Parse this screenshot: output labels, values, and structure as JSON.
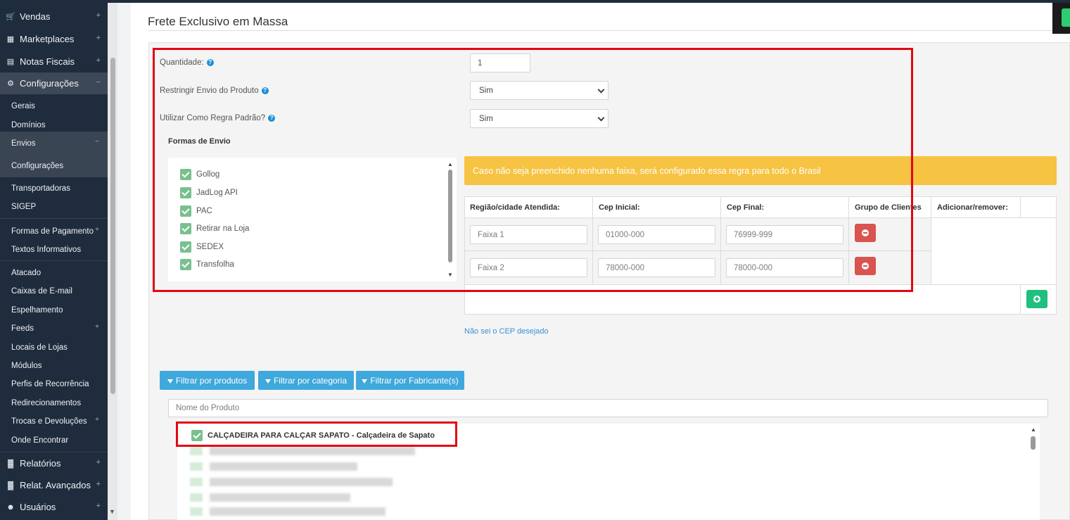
{
  "sidebar": {
    "vendas": "Vendas",
    "marketplaces": "Marketplaces",
    "notas": "Notas Fiscais",
    "configuracoes": "Configurações",
    "gerais": "Gerais",
    "dominios": "Domínios",
    "envios": "Envios",
    "envios_configuracoes": "Configurações",
    "transportadoras": "Transportadoras",
    "sigep": "SIGEP",
    "formas_pagamento": "Formas de Pagamento",
    "textos": "Textos Informativos",
    "atacado": "Atacado",
    "caixas": "Caixas de E-mail",
    "espelhamento": "Espelhamento",
    "feeds": "Feeds",
    "locais": "Locais de Lojas",
    "modulos": "Módulos",
    "perfis": "Perfis de Recorrência",
    "redirecionamentos": "Redirecionamentos",
    "trocas": "Trocas e Devoluções",
    "onde": "Onde Encontrar",
    "relatorios": "Relatórios",
    "relat_avancados": "Relat. Avançados",
    "usuarios": "Usuários",
    "plus": "+",
    "minus": "−"
  },
  "page": {
    "title": "Frete Exclusivo em Massa",
    "quantidade_label": "Quantidade:",
    "quantidade_value": "1",
    "restringir_label": "Restringir Envio do Produto",
    "restringir_value": "Sim",
    "regra_label": "Utilizar Como Regra Padrão?",
    "regra_value": "Sim",
    "help": "?"
  },
  "formas": {
    "title": "Formas de Envio",
    "items": [
      "Gollog",
      "JadLog API",
      "PAC",
      "Retirar na Loja",
      "SEDEX",
      "Transfolha"
    ]
  },
  "warning": "Caso não seja preenchido nenhuma faixa, será configurado essa regra para todo o Brasil",
  "table": {
    "headers": [
      "Região/cidade Atendida:",
      "Cep Inicial:",
      "Cep Final:",
      "Grupo de Clientes",
      "Adicionar/remover:"
    ],
    "rows": [
      {
        "regiao": "Faixa 1",
        "cep_inicial": "01000-000",
        "cep_final": "76999-999"
      },
      {
        "regiao": "Faixa 2",
        "cep_inicial": "78000-000",
        "cep_final": "78000-000"
      }
    ]
  },
  "cep_link": "Não sei o CEP desejado",
  "filters": [
    "Filtrar por produtos",
    "Filtrar por categoria",
    "Filtrar por Fabricante(s)"
  ],
  "product_search_placeholder": "Nome do Produto",
  "product_selected": "CALÇADEIRA PARA CALÇAR SAPATO - Calçadeira de Sapato",
  "colors": {
    "accent_blue": "#3fa8dc",
    "warning": "#f6c342",
    "danger": "#d9534f",
    "success": "#1fbf7f",
    "highlight": "#e30613"
  }
}
